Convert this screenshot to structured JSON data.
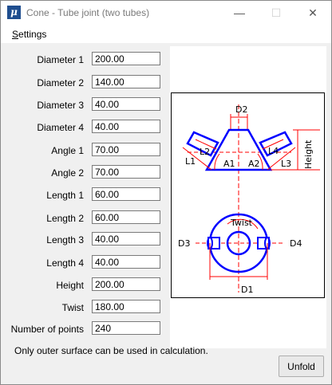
{
  "window": {
    "app_icon_letter": "μ",
    "title": "Cone - Tube joint (two tubes)",
    "minimize_glyph": "—",
    "maximize_glyph": "☐",
    "close_glyph": "✕"
  },
  "menu": {
    "settings_mnemonic": "S",
    "settings_rest": "ettings"
  },
  "fields": [
    {
      "label": "Diameter 1",
      "value": "200.00"
    },
    {
      "label": "Diameter 2",
      "value": "140.00"
    },
    {
      "label": "Diameter 3",
      "value": "40.00"
    },
    {
      "label": "Diameter 4",
      "value": "40.00"
    },
    {
      "label": "Angle 1",
      "value": "70.00"
    },
    {
      "label": "Angle 2",
      "value": "70.00"
    },
    {
      "label": "Length 1",
      "value": "60.00"
    },
    {
      "label": "Length 2",
      "value": "60.00"
    },
    {
      "label": "Length 3",
      "value": "40.00"
    },
    {
      "label": "Length 4",
      "value": "40.00"
    },
    {
      "label": "Height",
      "value": "200.00"
    },
    {
      "label": "Twist",
      "value": "180.00"
    },
    {
      "label": "Number of points",
      "value": "240"
    }
  ],
  "diagram": {
    "d2": "D2",
    "l1": "L1",
    "l2": "L2",
    "a1": "A1",
    "a2": "A2",
    "l3": "L3",
    "l4": "L4",
    "height": "Height",
    "twist": "Twist",
    "d3": "D3",
    "d4": "D4",
    "d1": "D1"
  },
  "note": "Only outer surface can be used in calculation.",
  "unfold_label": "Unfold",
  "colors": {
    "drawing_blue": "#0000ff",
    "drawing_red": "#ff0000"
  }
}
